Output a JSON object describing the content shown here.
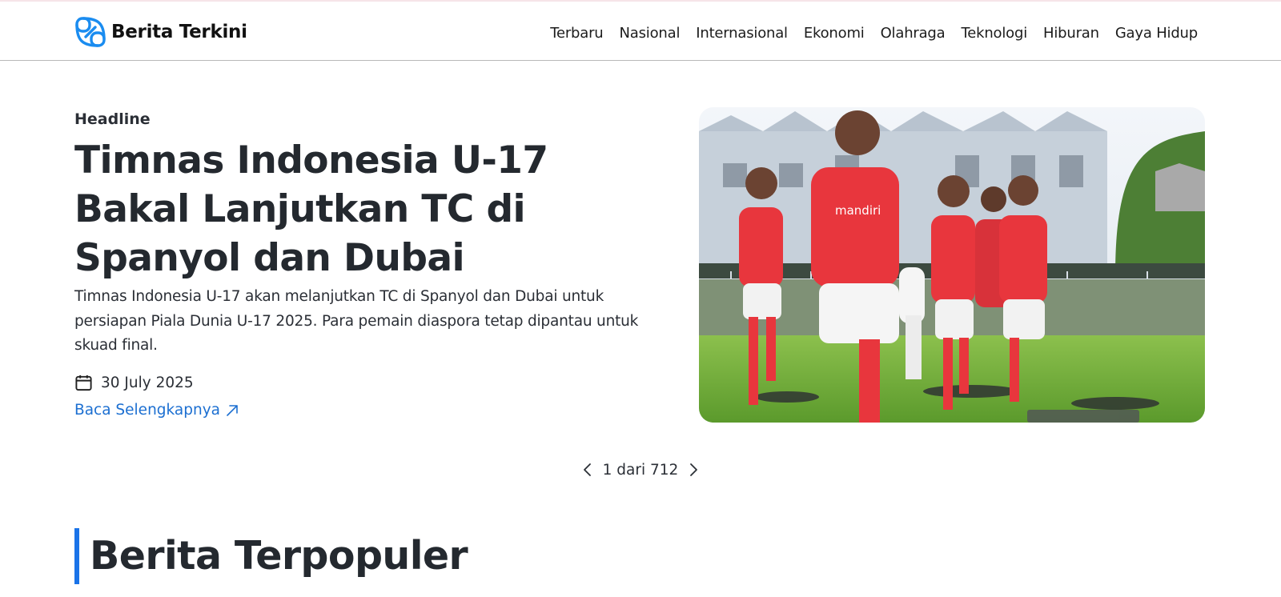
{
  "brand": {
    "name": "Berita Terkini",
    "color": "#1a8cf0"
  },
  "nav": {
    "items": [
      {
        "label": "Terbaru"
      },
      {
        "label": "Nasional"
      },
      {
        "label": "Internasional"
      },
      {
        "label": "Ekonomi"
      },
      {
        "label": "Olahraga"
      },
      {
        "label": "Teknologi"
      },
      {
        "label": "Hiburan"
      },
      {
        "label": "Gaya Hidup"
      }
    ]
  },
  "headline": {
    "kicker": "Headline",
    "title": "Timnas Indonesia U-17 Bakal Lanjutkan TC di Spanyol dan Dubai",
    "summary": "Timnas Indonesia U-17 akan melanjutkan TC di Spanyol dan Dubai untuk persiapan Piala Dunia U-17 2025. Para pemain diaspora tetap dipantau untuk skuad final.",
    "date": "30 July 2025",
    "date_icon": "calendar-icon",
    "read_more": "Baca Selengkapnya",
    "read_more_icon": "arrow-up-right-icon",
    "image_jersey_text": "mandiri"
  },
  "pager": {
    "text": "1 dari 712",
    "prev_icon": "chevron-left-icon",
    "next_icon": "chevron-right-icon"
  },
  "section": {
    "title": "Berita Terpopuler",
    "accent": "#1a73e8"
  },
  "colors": {
    "link": "#1c6fd1",
    "jersey": "#e8363d",
    "pitch": "#6fae3a"
  }
}
